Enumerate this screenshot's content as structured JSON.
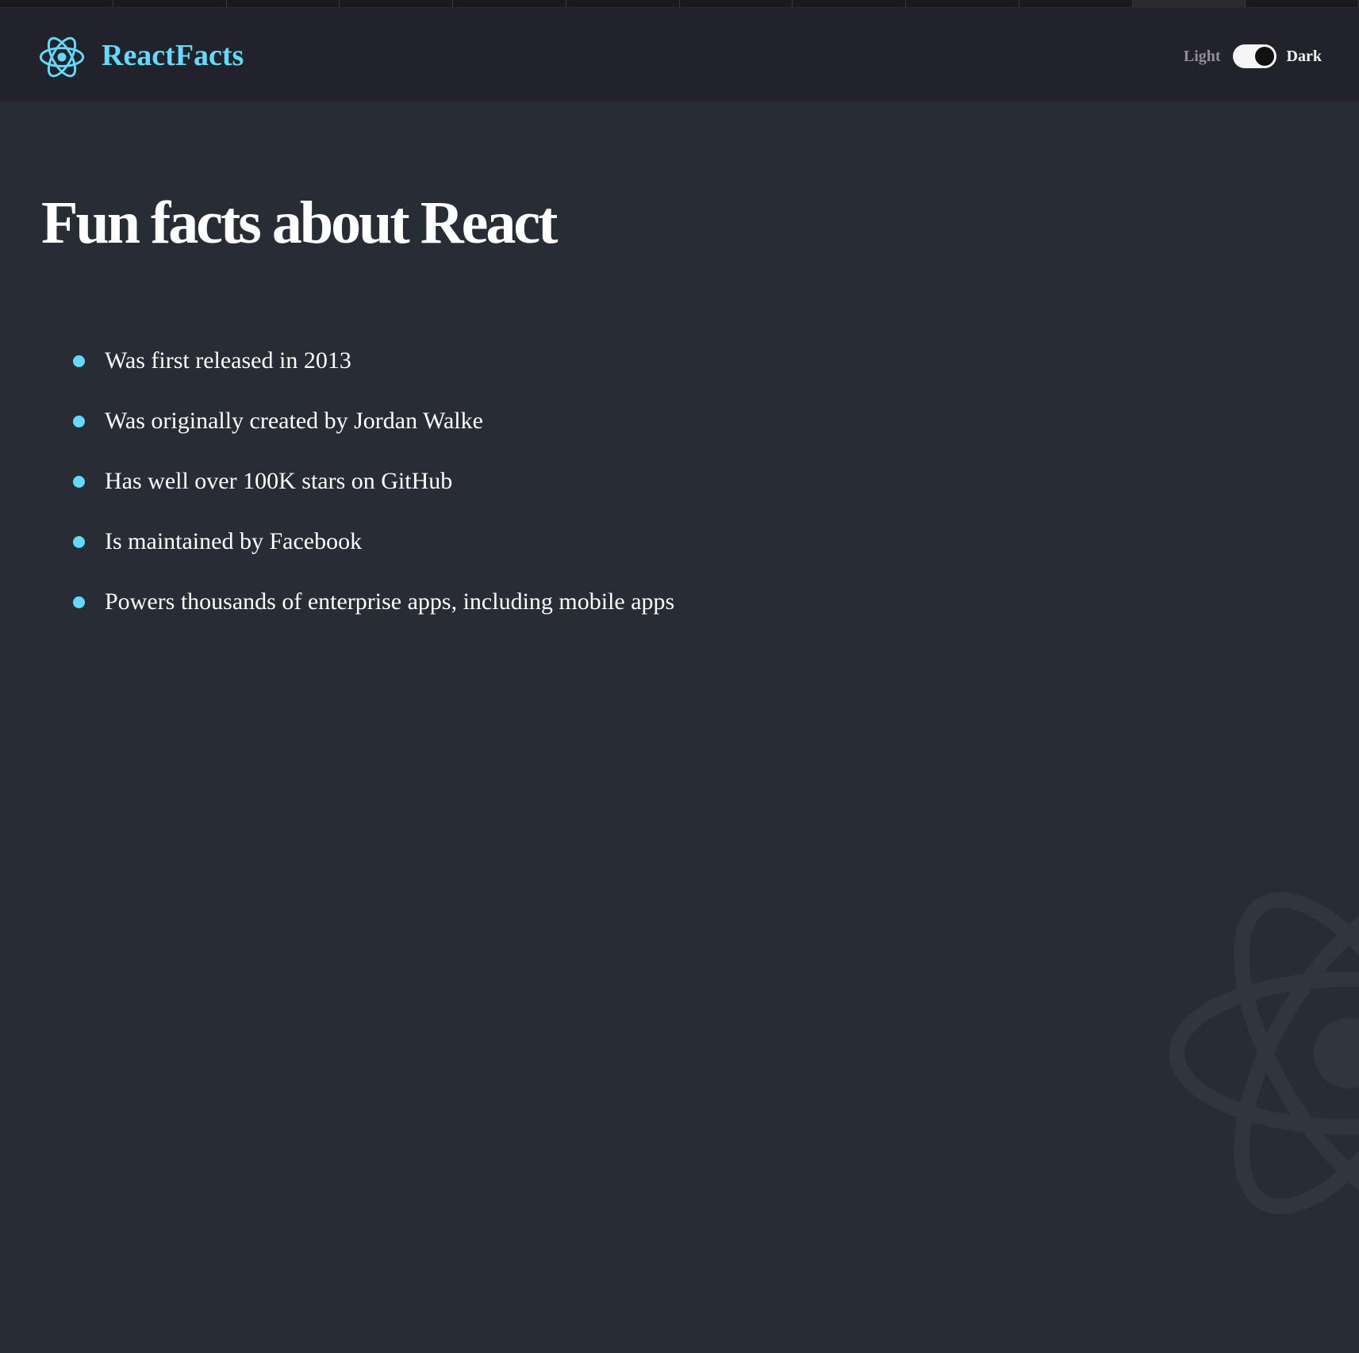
{
  "navbar": {
    "logo_icon": "react-atom-icon",
    "brand": "ReactFacts",
    "toggle": {
      "light_label": "Light",
      "dark_label": "Dark",
      "state": "dark"
    }
  },
  "main": {
    "title": "Fun facts about React",
    "facts": [
      "Was first released in 2013",
      "Was originally created by Jordan Walke",
      "Has well over 100K stars on GitHub",
      "Is maintained by Facebook",
      "Powers thousands of enterprise apps, including mobile apps"
    ],
    "background_icon": "react-atom-watermark-icon"
  },
  "colors": {
    "accent": "#61dafb",
    "nav_bg": "#21222a",
    "main_bg": "#282d35",
    "text": "#ffffff",
    "muted": "#918e9b"
  }
}
